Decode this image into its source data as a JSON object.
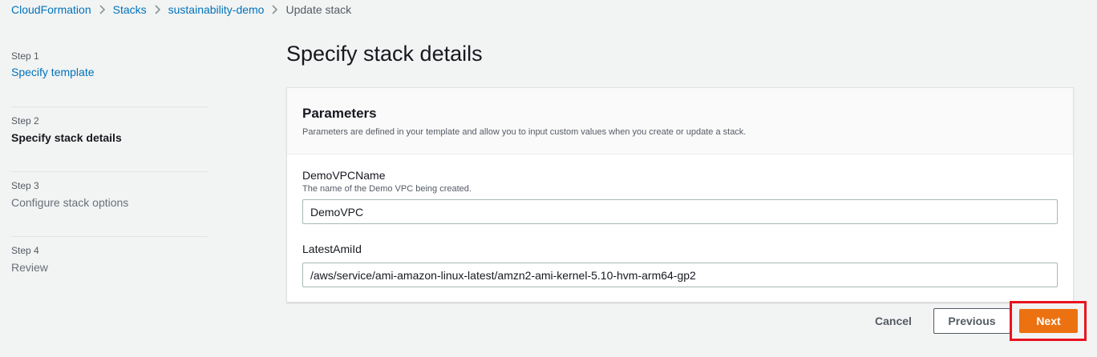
{
  "breadcrumb": {
    "items": [
      "CloudFormation",
      "Stacks",
      "sustainability-demo"
    ],
    "current": "Update stack"
  },
  "steps": [
    {
      "num": "Step 1",
      "title": "Specify template"
    },
    {
      "num": "Step 2",
      "title": "Specify stack details"
    },
    {
      "num": "Step 3",
      "title": "Configure stack options"
    },
    {
      "num": "Step 4",
      "title": "Review"
    }
  ],
  "page_title": "Specify stack details",
  "parameters": {
    "title": "Parameters",
    "description": "Parameters are defined in your template and allow you to input custom values when you create or update a stack.",
    "fields": [
      {
        "label": "DemoVPCName",
        "description": "The name of the Demo VPC being created.",
        "value": "DemoVPC"
      },
      {
        "label": "LatestAmiId",
        "value": "/aws/service/ami-amazon-linux-latest/amzn2-ami-kernel-5.10-hvm-arm64-gp2"
      }
    ]
  },
  "actions": {
    "cancel": "Cancel",
    "previous": "Previous",
    "next": "Next"
  },
  "colors": {
    "link": "#0073bb",
    "primary_button": "#ec7211",
    "highlight_box": "#e8141f"
  }
}
